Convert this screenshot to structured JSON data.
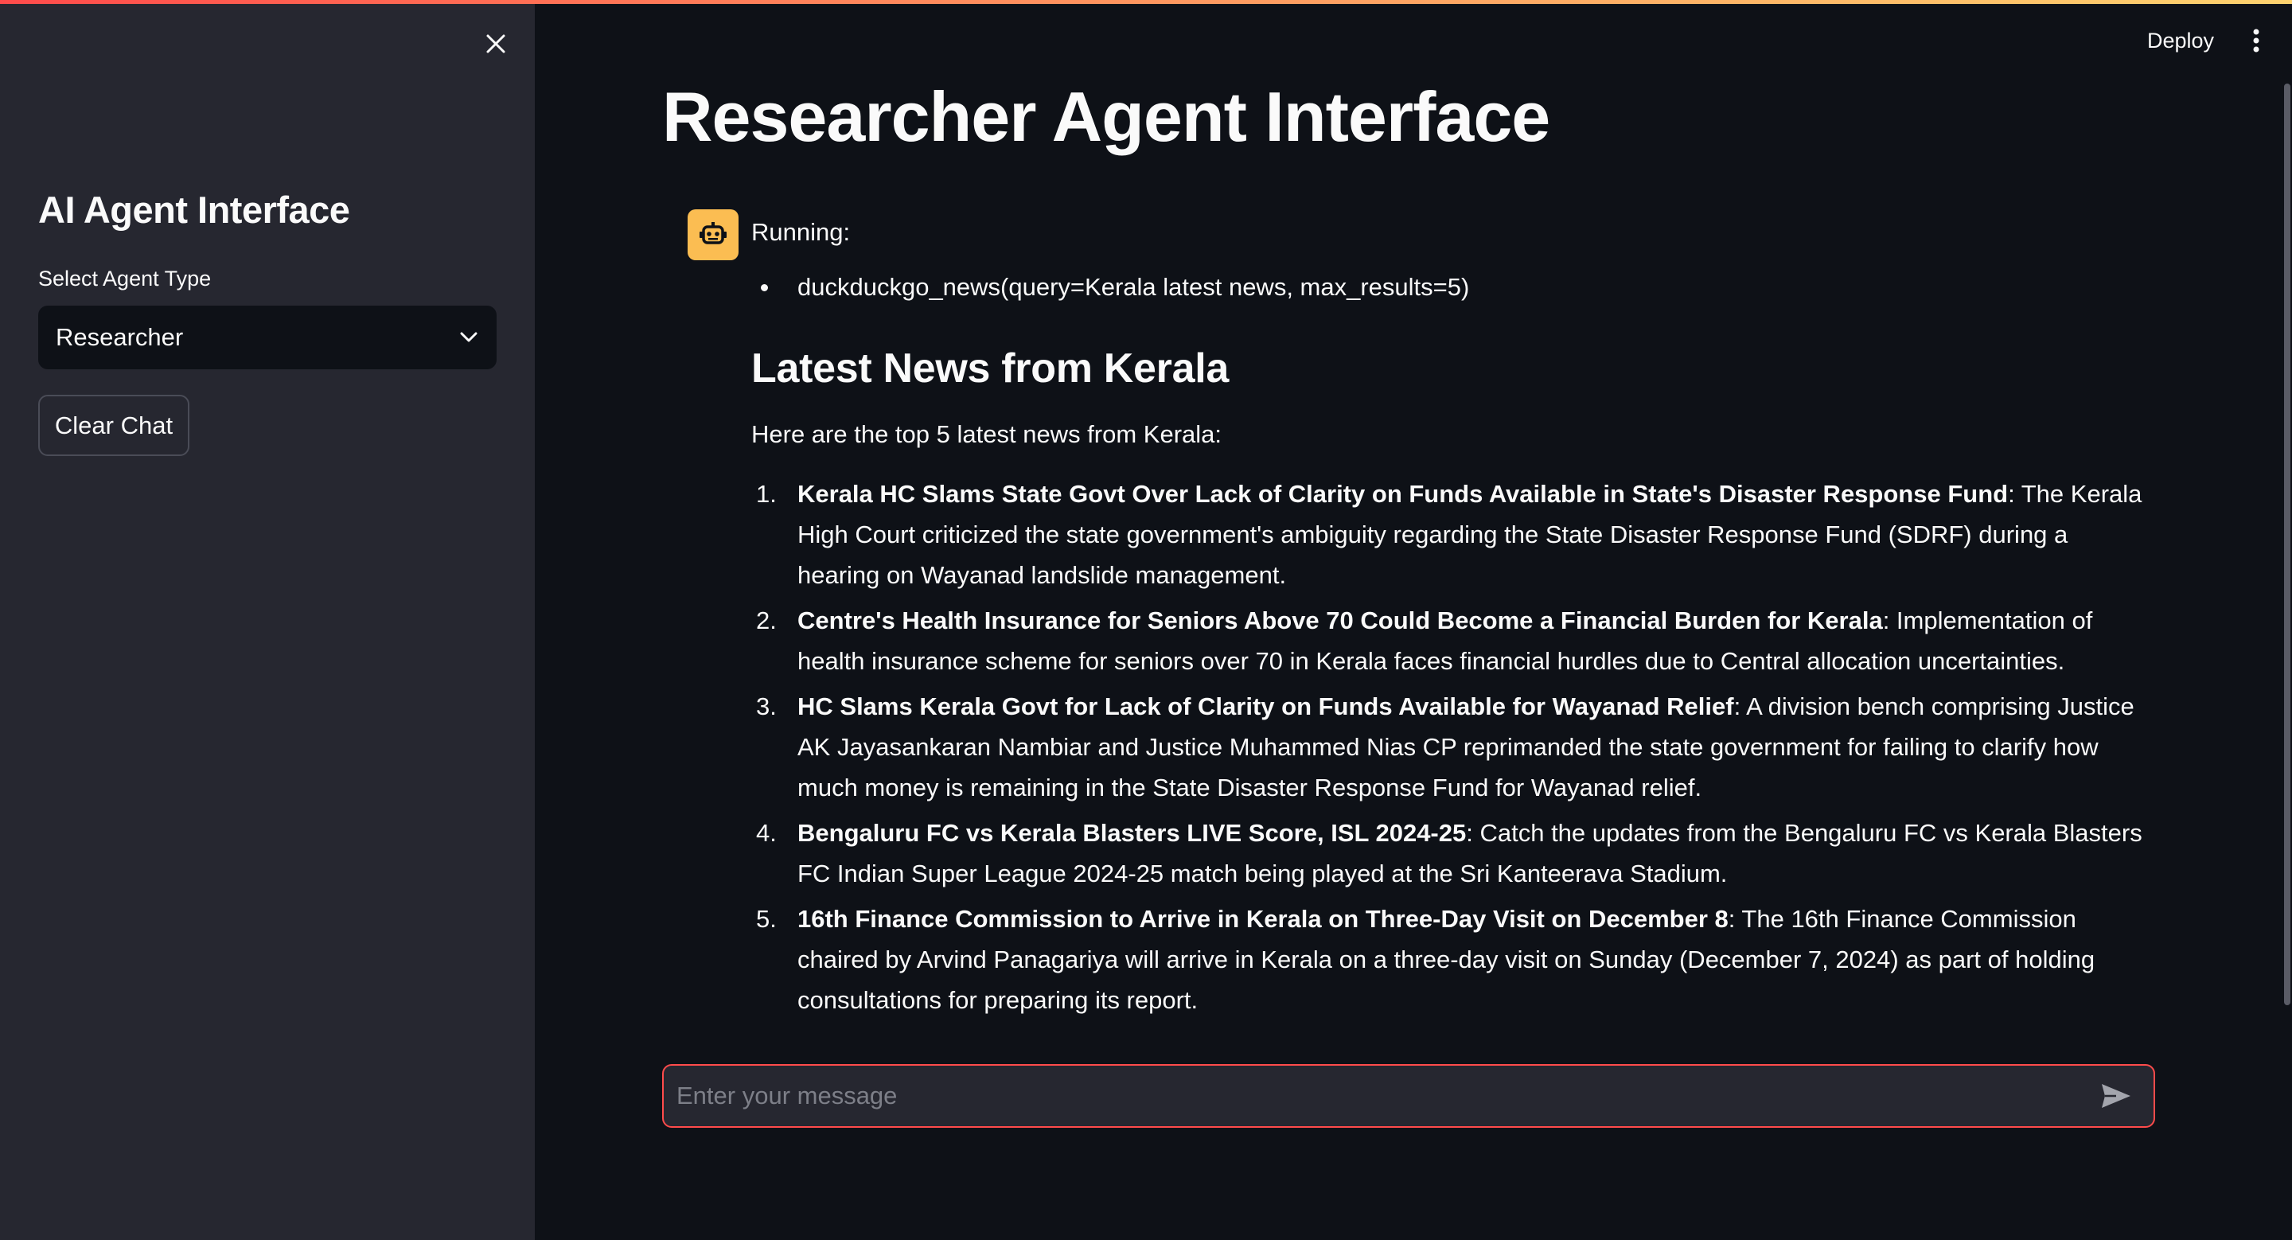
{
  "accent_color": "#ff4b4b",
  "sidebar": {
    "close_icon": "close-icon",
    "title": "AI Agent Interface",
    "select_label": "Select Agent Type",
    "select_value": "Researcher",
    "clear_button": "Clear Chat"
  },
  "header": {
    "deploy_label": "Deploy",
    "menu_icon": "more-vertical-icon"
  },
  "main": {
    "title": "Researcher Agent Interface",
    "message": {
      "avatar_icon": "robot-icon",
      "running_label": "Running:",
      "tool_calls": [
        "duckduckgo_news(query=Kerala latest news, max_results=5)"
      ],
      "heading": "Latest News from Kerala",
      "intro": "Here are the top 5 latest news from Kerala:",
      "news": [
        {
          "num": "1.",
          "title": "Kerala HC Slams State Govt Over Lack of Clarity on Funds Available in State's Disaster Response Fund",
          "body": ": The Kerala High Court criticized the state government's ambiguity regarding the State Disaster Response Fund (SDRF) during a hearing on Wayanad landslide management."
        },
        {
          "num": "2.",
          "title": "Centre's Health Insurance for Seniors Above 70 Could Become a Financial Burden for Kerala",
          "body": ": Implementation of health insurance scheme for seniors over 70 in Kerala faces financial hurdles due to Central allocation uncertainties."
        },
        {
          "num": "3.",
          "title": "HC Slams Kerala Govt for Lack of Clarity on Funds Available for Wayanad Relief",
          "body": ": A division bench comprising Justice AK Jayasankaran Nambiar and Justice Muhammed Nias CP reprimanded the state government for failing to clarify how much money is remaining in the State Disaster Response Fund for Wayanad relief."
        },
        {
          "num": "4.",
          "title": "Bengaluru FC vs Kerala Blasters LIVE Score, ISL 2024-25",
          "body": ": Catch the updates from the Bengaluru FC vs Kerala Blasters FC Indian Super League 2024-25 match being played at the Sri Kanteerava Stadium."
        },
        {
          "num": "5.",
          "title": "16th Finance Commission to Arrive in Kerala on Three-Day Visit on December 8",
          "body": ": The 16th Finance Commission chaired by Arvind Panagariya will arrive in Kerala on a three-day visit on Sunday (December 7, 2024) as part of holding consultations for preparing its report."
        }
      ]
    }
  },
  "chat_input": {
    "placeholder": "Enter your message",
    "value": "",
    "send_icon": "send-icon"
  }
}
